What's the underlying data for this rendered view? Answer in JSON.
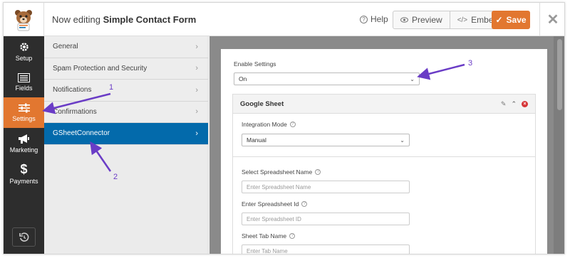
{
  "header": {
    "editing_prefix": "Now editing",
    "form_name": "Simple Contact Form",
    "help_label": "Help",
    "preview_label": "Preview",
    "embed_label": "Embed",
    "save_label": "Save"
  },
  "leftnav": {
    "items": [
      {
        "label": "Setup",
        "icon": "gear-icon"
      },
      {
        "label": "Fields",
        "icon": "fields-list-icon"
      },
      {
        "label": "Settings",
        "icon": "sliders-icon",
        "active": true
      },
      {
        "label": "Marketing",
        "icon": "megaphone-icon"
      },
      {
        "label": "Payments",
        "icon": "dollar-icon"
      }
    ],
    "bottom_icon": "revisions-history-icon"
  },
  "settings_panel": {
    "items": [
      {
        "label": "General"
      },
      {
        "label": "Spam Protection and Security"
      },
      {
        "label": "Notifications"
      },
      {
        "label": "Confirmations"
      },
      {
        "label": "GSheetConnector",
        "active": true
      }
    ]
  },
  "content": {
    "enable_settings": {
      "label": "Enable Settings",
      "value": "On"
    },
    "google_sheet": {
      "title": "Google Sheet",
      "integration_mode": {
        "label": "Integration Mode",
        "value": "Manual"
      },
      "spreadsheet_name": {
        "label": "Select Spreadsheet Name",
        "placeholder": "Enter Spreadsheet Name"
      },
      "spreadsheet_id": {
        "label": "Enter Spreadsheet Id",
        "placeholder": "Enter Spreadsheet ID"
      },
      "sheet_tab_name": {
        "label": "Sheet Tab Name",
        "placeholder": "Enter Tab Name"
      }
    }
  },
  "annotations": {
    "a1": "1",
    "a2": "2",
    "a3": "3",
    "color": "#6a3cc6"
  },
  "colors": {
    "accent": "#e27730",
    "nav_active": "#036aab",
    "nav_bg": "#2d2d2d"
  }
}
